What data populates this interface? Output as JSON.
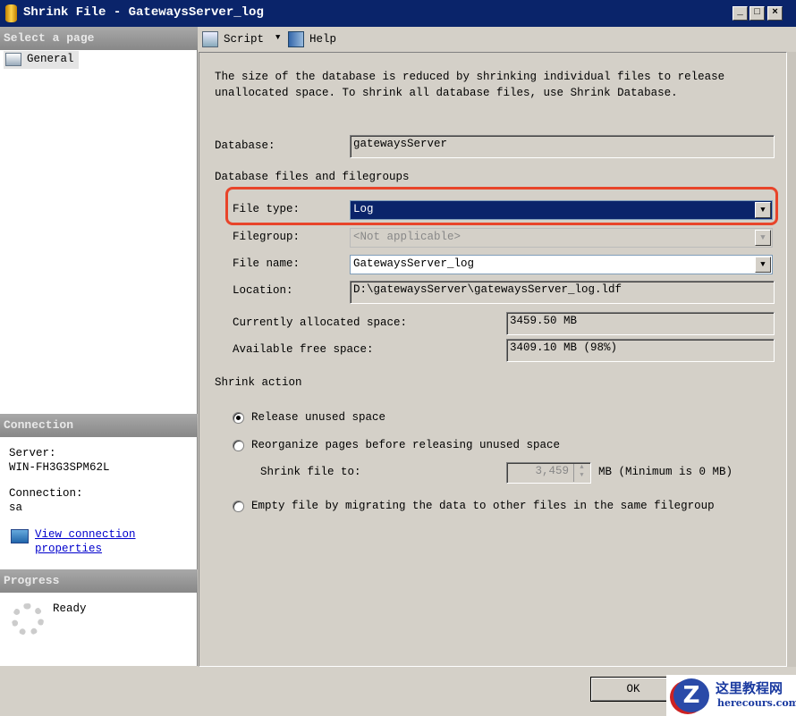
{
  "window": {
    "title": "Shrink File - GatewaysServer_log"
  },
  "left": {
    "select_header": "Select a page",
    "pages": [
      {
        "label": "General"
      }
    ],
    "connection_header": "Connection",
    "server_label": "Server:",
    "server_value": "WIN-FH3G3SPM62L",
    "connection_label": "Connection:",
    "connection_value": "sa",
    "view_link_1": "View connection",
    "view_link_2": "properties",
    "progress_header": "Progress",
    "progress_status": "Ready"
  },
  "toolbar": {
    "script": "Script",
    "help": "Help"
  },
  "main": {
    "description_1": "The size of the database is reduced by shrinking individual files to release",
    "description_2": "unallocated space. To shrink all database files, use Shrink Database.",
    "database_label": "Database:",
    "database_value": "gatewaysServer",
    "files_section": "Database files and filegroups",
    "file_type_label": "File type:",
    "file_type_value": "Log",
    "filegroup_label": "Filegroup:",
    "filegroup_value": "<Not applicable>",
    "file_name_label": "File name:",
    "file_name_value": "GatewaysServer_log",
    "location_label": "Location:",
    "location_value": "D:\\gatewaysServer\\gatewaysServer_log.ldf",
    "allocated_label": "Currently allocated space:",
    "allocated_value": "3459.50 MB",
    "free_label": "Available free space:",
    "free_value": "3409.10 MB (98%)",
    "shrink_section": "Shrink action",
    "opt_release": "Release unused space",
    "opt_reorganize": "Reorganize pages before releasing unused space",
    "shrink_to_label": "Shrink file to:",
    "shrink_to_value": "3,459",
    "shrink_to_unit": "MB (Minimum is 0 MB)",
    "opt_empty": "Empty file by migrating the data to other files in the same filegroup"
  },
  "footer": {
    "ok": "OK"
  },
  "watermark": {
    "text": "这里教程网",
    "url": "herecours.com"
  },
  "colors": {
    "titlebar": "#0a246a",
    "highlight": "#e8442a"
  }
}
